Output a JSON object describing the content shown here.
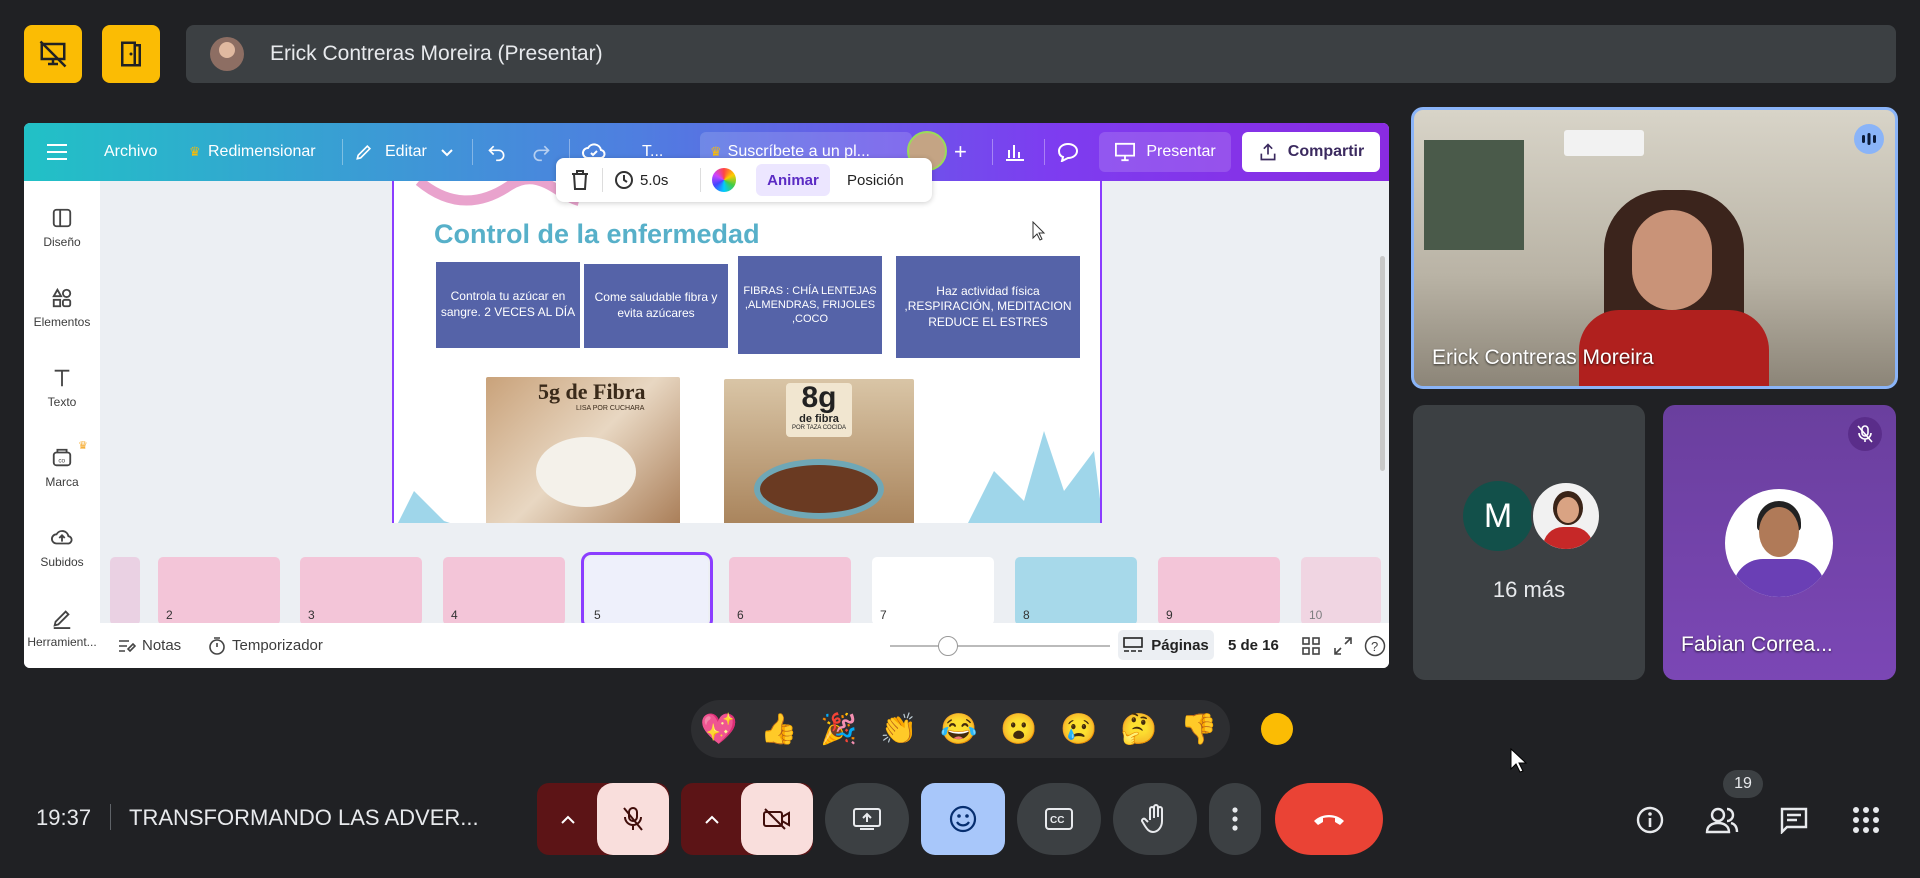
{
  "top": {
    "presenter_name": "Erick Contreras Moreira (Presentar)"
  },
  "canva": {
    "menu": {
      "archivo": "Archivo",
      "redimensionar": "Redimensionar",
      "editar": "Editar",
      "text_short": "T...",
      "suscribete": "Suscríbete a un pl...",
      "presentar": "Presentar",
      "compartir": "Compartir"
    },
    "sidebar": [
      {
        "label": "Diseño"
      },
      {
        "label": "Elementos"
      },
      {
        "label": "Texto"
      },
      {
        "label": "Marca"
      },
      {
        "label": "Subidos"
      },
      {
        "label": "Herramient..."
      }
    ],
    "float_toolbar": {
      "duration": "5.0s",
      "animar": "Animar",
      "posicion": "Posición"
    },
    "slide": {
      "title": "Control de la enfermedad",
      "boxes": [
        "Controla tu azúcar en sangre. 2 VECES AL DÍA",
        "Come saludable fibra y evita azúcares",
        "FIBRAS : CHÍA LENTEJAS ,ALMENDRAS, FRIJOLES ,COCO",
        "Haz actividad física ,RESPIRACIÓN, MEDITACION REDUCE EL ESTRES"
      ],
      "img1_text": "5g de Fibra",
      "img1_sub": "LISA POR CUCHARA",
      "img2_text": "8g",
      "img2_sub": "de fibra",
      "img2_sub2": "POR TAZA COCIDA"
    },
    "thumbnails": [
      "2",
      "3",
      "4",
      "5",
      "6",
      "7",
      "8",
      "9",
      "10"
    ],
    "bottom": {
      "notas": "Notas",
      "temporizador": "Temporizador",
      "zoom": "33%",
      "paginas": "Páginas",
      "page_of": "5 de 16"
    }
  },
  "participants": {
    "main_name": "Erick Contreras Moreira",
    "more_initial": "M",
    "more_label": "16 más",
    "fabian_name": "Fabian Correa..."
  },
  "reactions": [
    "💖",
    "👍",
    "🎉",
    "👏",
    "😂",
    "😮",
    "😢",
    "🤔",
    "👎"
  ],
  "bottom_bar": {
    "time": "19:37",
    "meeting_title": "TRANSFORMANDO LAS ADVER...",
    "participants_count": "19"
  },
  "colors": {
    "accent_yellow": "#fbbc04",
    "end_call_red": "#ea4335",
    "mic_off_bg": "#f9dedc",
    "emoji_btn_bg": "#a8c7fa",
    "canva_purple": "#8b3dff"
  }
}
